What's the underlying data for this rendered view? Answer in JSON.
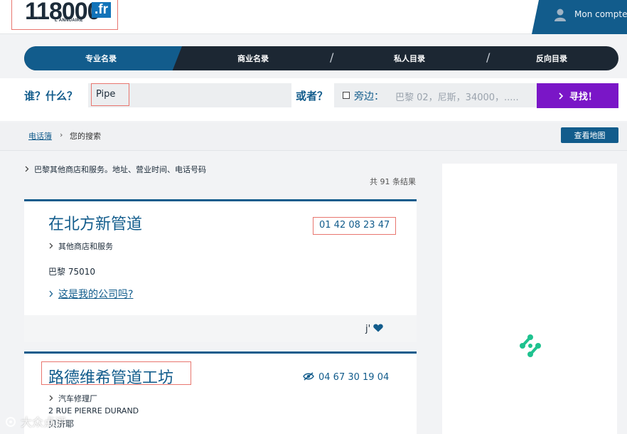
{
  "header": {
    "logo_number": "118000",
    "logo_tld": ".fr",
    "logo_tagline": "L'ANNUAIRE",
    "account_label": "Mon compte"
  },
  "nav": {
    "tabs": [
      {
        "label": "专业名录",
        "active": true
      },
      {
        "label": "商业名录",
        "active": false
      },
      {
        "label": "私人目录",
        "active": false
      },
      {
        "label": "反向目录",
        "active": false
      }
    ],
    "separator": "/"
  },
  "search": {
    "who_label": "谁？什么？",
    "who_value": "Pipe",
    "or_label": "或者？",
    "near_label": "旁边：",
    "where_placeholder": "巴黎 02，尼斯，34000，.....",
    "submit_label": "寻找！",
    "submit_icon": "chevron-right-icon"
  },
  "breadcrumb": {
    "home": "电话簿",
    "separator": "›",
    "current": "您的搜索"
  },
  "map_button": "查看地图",
  "results": {
    "description": "巴黎其他商店和服务。地址、营业时间、电话号码",
    "count": "共 91 条结果",
    "items": [
      {
        "title": "在北方新管道",
        "phone": "01 42 08 23 47",
        "category": "其他商店和服务",
        "city": "巴黎 75010",
        "claim": "这是我的公司吗?",
        "like_label": "j'"
      },
      {
        "title": "路德维希管道工坊",
        "phone": "04 67 30 19 04",
        "category": "汽车修理厂",
        "street": "2 RUE PIERRE DURAND",
        "city": "贝济耶"
      }
    ]
  },
  "watermark": "大众点评",
  "colors": {
    "primary": "#125c8c",
    "nav_dark": "#1c2733",
    "accent_purple": "#7a16c7",
    "highlight_box": "#e8766f",
    "loader_green": "#1fc28f"
  }
}
